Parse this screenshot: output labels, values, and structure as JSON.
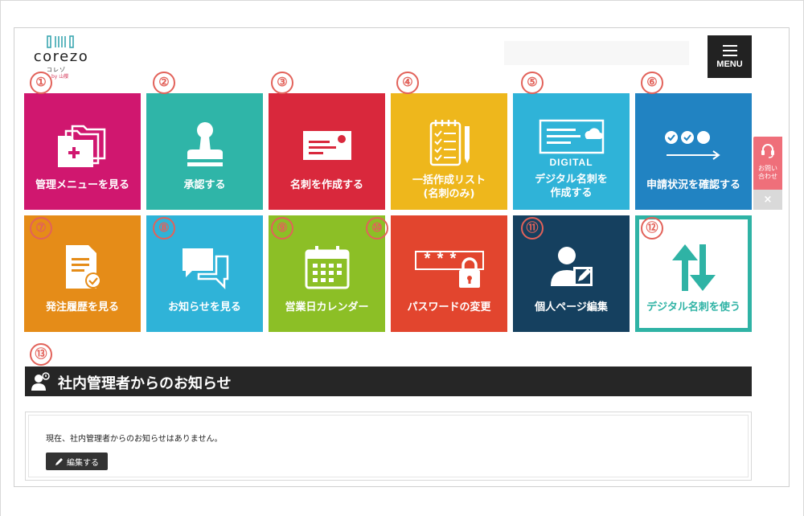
{
  "header": {
    "logo_word": "corezo",
    "logo_kana": "コレゾ",
    "logo_sub": "by 山櫻",
    "menu_label": "MENU"
  },
  "numbers": [
    "①",
    "②",
    "③",
    "④",
    "⑤",
    "⑥",
    "⑦",
    "⑧",
    "⑨",
    "⑩",
    "⑪",
    "⑫",
    "⑬"
  ],
  "tiles": [
    {
      "label": "管理メニューを見る",
      "color": "#d0176f",
      "icon": "folders-icon"
    },
    {
      "label": "承認する",
      "color": "#2fb5a8",
      "icon": "stamp-icon"
    },
    {
      "label": "名刺を作成する",
      "color": "#d9283c",
      "icon": "business-card-icon"
    },
    {
      "label_line1": "一括作成リスト",
      "label_line2": "(名刺のみ)",
      "color": "#eeb71c",
      "icon": "checklist-icon"
    },
    {
      "label_line1": "デジタル名刺を",
      "label_line2": "作成する",
      "card_text": "DIGITAL",
      "color": "#2fb3d8",
      "icon": "digital-card-icon"
    },
    {
      "label": "申請状況を確認する",
      "color": "#2183c2",
      "icon": "progress-steps-icon"
    },
    {
      "label": "発注履歴を見る",
      "color": "#e58c18",
      "icon": "order-document-icon"
    },
    {
      "label": "お知らせを見る",
      "color": "#2fb3d8",
      "icon": "chat-bubbles-icon"
    },
    {
      "label": "営業日カレンダー",
      "color": "#8cbf26",
      "icon": "calendar-icon"
    },
    {
      "label": "パスワードの変更",
      "color": "#e2452e",
      "icon": "password-lock-icon",
      "mask": "***"
    },
    {
      "label": "個人ページ編集",
      "color": "#15405f",
      "icon": "user-edit-icon"
    },
    {
      "label": "デジタル名刺を使う",
      "color": "#2fb3a5",
      "icon": "exchange-arrows-icon"
    }
  ],
  "notice": {
    "title": "社内管理者からのお知らせ",
    "message": "現在、社内管理者からのお知らせはありません。",
    "edit_label": "編集する"
  },
  "side": {
    "contact_line1": "お問い",
    "contact_line2": "合わせ",
    "close": "×"
  }
}
